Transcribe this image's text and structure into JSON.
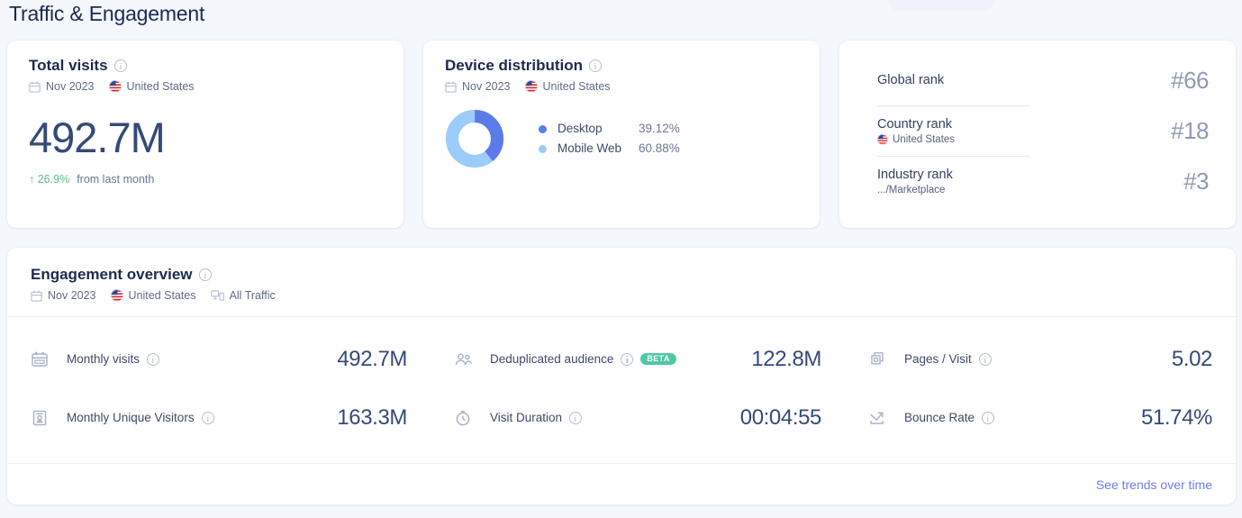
{
  "page": {
    "title": "Traffic & Engagement",
    "background_color": "#f4f7fc"
  },
  "colors": {
    "accent_link": "#6a7df5",
    "value_text": "#35497a",
    "positive": "#5cc08a",
    "beta_badge": "#4ec9a4",
    "donut_desktop": "#5b7ce8",
    "donut_mobile": "#9bccfb"
  },
  "total_visits": {
    "title": "Total visits",
    "info_icon": "info-circle-icon",
    "calendar_icon": "calendar-icon",
    "date": "Nov 2023",
    "flag_icon": "us-flag-icon",
    "country": "United States",
    "value": "492.7M",
    "delta_arrow": "↑",
    "delta": "26.9%",
    "delta_caption": "from last month"
  },
  "device_distribution": {
    "title": "Device distribution",
    "info_icon": "info-circle-icon",
    "calendar_icon": "calendar-icon",
    "date": "Nov 2023",
    "flag_icon": "us-flag-icon",
    "country": "United States",
    "legend": [
      {
        "name": "Desktop",
        "percent": "39.12%",
        "color": "#5b7ce8"
      },
      {
        "name": "Mobile Web",
        "percent": "60.88%",
        "color": "#9bccfb"
      }
    ]
  },
  "ranks": [
    {
      "label": "Global rank",
      "meta": "",
      "flag_icon": "",
      "value": "#66"
    },
    {
      "label": "Country rank",
      "meta": "United States",
      "flag_icon": "us-flag-icon",
      "value": "#18"
    },
    {
      "label": "Industry rank",
      "meta": ".../Marketplace",
      "flag_icon": "",
      "value": "#3"
    }
  ],
  "engagement": {
    "title": "Engagement overview",
    "info_icon": "info-circle-icon",
    "calendar_icon": "calendar-icon",
    "date": "Nov 2023",
    "flag_icon": "us-flag-icon",
    "country": "United States",
    "traffic_icon": "devices-icon",
    "traffic": "All Traffic",
    "metrics": {
      "col1": [
        {
          "icon": "calendar-icon",
          "label": "Monthly visits",
          "info_icon": "info-circle-icon",
          "badge": "",
          "value": "492.7M"
        },
        {
          "icon": "visitor-card-icon",
          "label": "Monthly Unique Visitors",
          "info_icon": "info-circle-icon",
          "badge": "",
          "value": "163.3M"
        }
      ],
      "col2": [
        {
          "icon": "people-icon",
          "label": "Deduplicated audience",
          "info_icon": "info-circle-icon",
          "badge": "BETA",
          "value": "122.8M"
        },
        {
          "icon": "clock-icon",
          "label": "Visit Duration",
          "info_icon": "info-circle-icon",
          "badge": "",
          "value": "00:04:55"
        }
      ],
      "col3": [
        {
          "icon": "pages-icon",
          "label": "Pages / Visit",
          "info_icon": "info-circle-icon",
          "badge": "",
          "value": "5.02"
        },
        {
          "icon": "bounce-arrow-icon",
          "label": "Bounce Rate",
          "info_icon": "info-circle-icon",
          "badge": "",
          "value": "51.74%"
        }
      ]
    },
    "footer_link": "See trends over time"
  },
  "chart_data": {
    "type": "pie",
    "title": "Device distribution",
    "categories": [
      "Desktop",
      "Mobile Web"
    ],
    "values": [
      39.12,
      60.88
    ],
    "unit": "%",
    "colors": [
      "#5b7ce8",
      "#9bccfb"
    ],
    "legend_position": "right",
    "donut": true,
    "inner_radius_ratio": 0.55
  }
}
